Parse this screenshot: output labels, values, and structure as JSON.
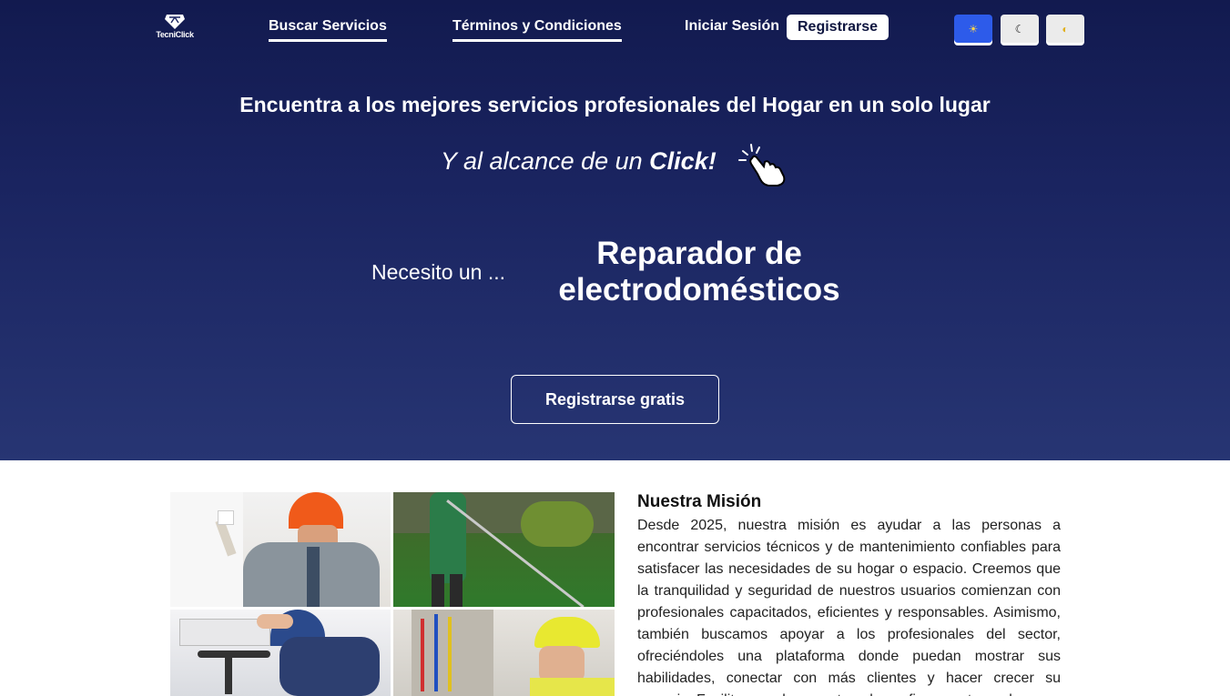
{
  "brand": {
    "logo_text": "TecniClick"
  },
  "nav": {
    "search_label": "Buscar Servicios",
    "terms_label": "Términos y Condiciones",
    "login_label": "Iniciar Sesión",
    "register_label": "Registrarse"
  },
  "theme_buttons": [
    {
      "icon": "sun-icon",
      "glyph": "☀",
      "active": true
    },
    {
      "icon": "moon-icon",
      "glyph": "☾",
      "active": false
    },
    {
      "icon": "auto-theme-icon",
      "glyph": "◐",
      "active": false
    }
  ],
  "hero": {
    "title": "Encuentra a los mejores servicios profesionales del Hogar en un solo lugar",
    "subtitle_prefix": "Y al alcance de un ",
    "subtitle_emphasis": "Click!",
    "need_label": "Necesito un ...",
    "need_value": "Reparador de electrodomésticos",
    "cta_label": "Registrarse gratis"
  },
  "mission": {
    "title": "Nuestra Misión",
    "text": "Desde 2025, nuestra misión es ayudar a las personas a encontrar servicios técnicos y de mantenimiento confiables para satisfacer las necesidades de su hogar o espacio. Creemos que la tranquilidad y seguridad de nuestros usuarios comienzan con profesionales capacitados, eficientes y responsables. Asimismo, también buscamos apoyar a los profesionales del sector, ofreciéndoles una plataforma donde puedan mostrar sus habilidades, conectar con más clientes y hacer crecer su negocio. Facilitamos el encuentro y la confianza entre ambos."
  },
  "colors": {
    "hero_top": "#121a4f",
    "hero_bottom": "#273573",
    "theme_active": "#2d5bea"
  }
}
